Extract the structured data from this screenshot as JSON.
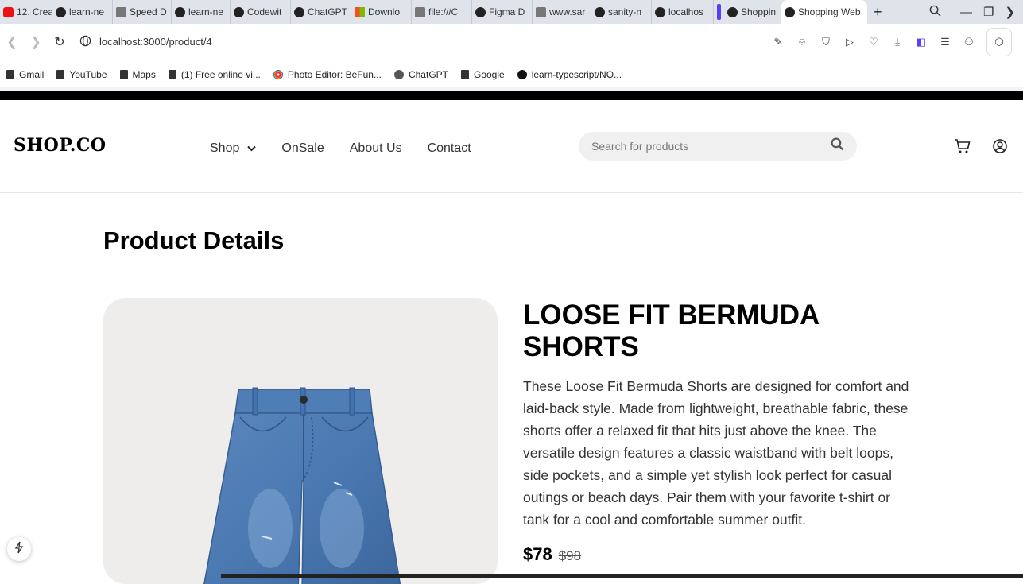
{
  "browser": {
    "tabs": [
      {
        "label": "12. Crea",
        "icon": "youtube-icon"
      },
      {
        "label": "learn-ne",
        "icon": "github-icon"
      },
      {
        "label": "Speed D",
        "icon": "grid-icon"
      },
      {
        "label": "learn-ne",
        "icon": "github-icon"
      },
      {
        "label": "Codewit",
        "icon": "github-icon"
      },
      {
        "label": "ChatGPT",
        "icon": "chatgpt-icon"
      },
      {
        "label": "Downlo",
        "icon": "microsoft-icon"
      },
      {
        "label": "file:///C",
        "icon": "file-icon"
      },
      {
        "label": "Figma D",
        "icon": "vercel-icon"
      },
      {
        "label": "www.sar",
        "icon": "file-icon"
      },
      {
        "label": "sanity-n",
        "icon": "github-icon"
      },
      {
        "label": "localhos",
        "icon": "vercel-icon"
      },
      {
        "label": "Shoppin",
        "icon": "vercel-icon"
      },
      {
        "label": "Shopping Web",
        "icon": "vercel-icon",
        "active": true
      }
    ],
    "url": "localhost:3000/product/4",
    "bookmarks": [
      {
        "label": "Gmail"
      },
      {
        "label": "YouTube"
      },
      {
        "label": "Maps"
      },
      {
        "label": "(1)  Free online vi..."
      },
      {
        "label": "Photo Editor: BeFun..."
      },
      {
        "label": "ChatGPT"
      },
      {
        "label": "Google"
      },
      {
        "label": "learn-typescript/NO..."
      }
    ]
  },
  "site": {
    "logo": "SHOP.CO",
    "nav": {
      "shop": "Shop",
      "onsale": "OnSale",
      "about": "About Us",
      "contact": "Contact"
    },
    "search_placeholder": "Search for products"
  },
  "page": {
    "title": "Product Details",
    "product": {
      "name": "LOOSE FIT BERMUDA SHORTS",
      "description": "These Loose Fit Bermuda Shorts are designed for comfort and laid-back style. Made from lightweight, breathable fabric, these shorts offer a relaxed fit that hits just above the knee. The versatile design features a classic waistband with belt loops, side pockets, and a simple yet stylish look perfect for casual outings or beach days. Pair them with your favorite t-shirt or tank for a cool and comfortable summer outfit.",
      "price": "$78",
      "original_price": "$98"
    }
  },
  "colors": {
    "accent": "#5b3df5",
    "image_bg": "#efedeb",
    "denim": "#4a78b0"
  }
}
